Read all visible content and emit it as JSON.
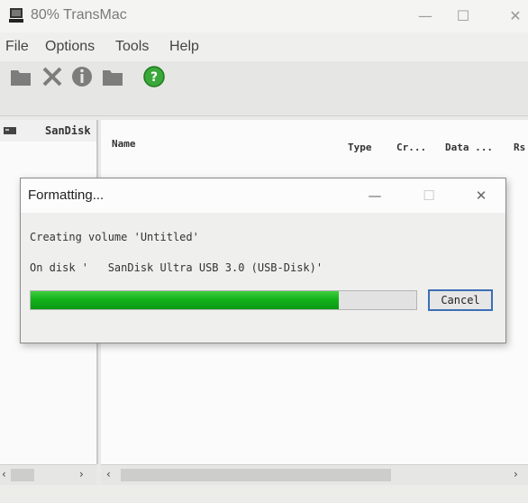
{
  "app": {
    "title": "80% TransMac"
  },
  "menu": {
    "items": [
      "File",
      "Options",
      "Tools",
      "Help"
    ]
  },
  "toolbar": {
    "icons": [
      "folder-icon",
      "delete-icon",
      "info-icon",
      "folder-open-icon",
      "help-icon"
    ]
  },
  "left_pane": {
    "header": "SanDisk"
  },
  "file_list": {
    "columns": [
      "Name",
      "Type",
      "Cr...",
      "Data ...",
      "Rs"
    ]
  },
  "dialog": {
    "title": "Formatting...",
    "line1": "Creating volume 'Untitled'",
    "line2": "On disk '   SanDisk Ultra USB 3.0 (USB-Disk)'",
    "progress": 0.8,
    "cancel": "Cancel"
  },
  "colors": {
    "progress": "#15b21c",
    "button_focus": "#3c6fb5"
  }
}
